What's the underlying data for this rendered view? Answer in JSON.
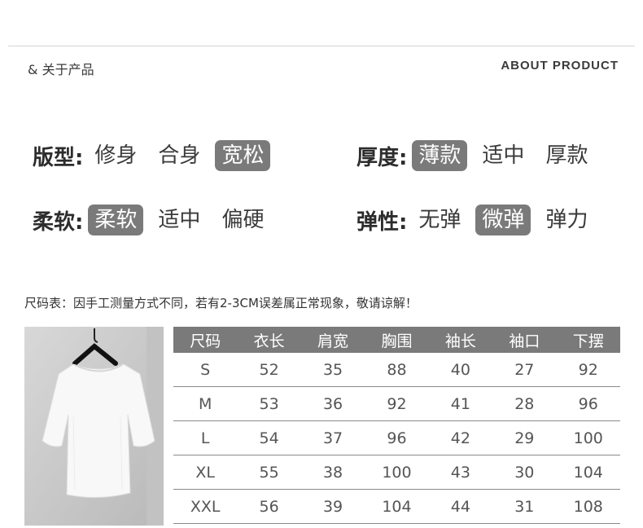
{
  "header": {
    "left": "& 关于产品",
    "right": "ABOUT PRODUCT"
  },
  "attributes": [
    {
      "label": "版型:",
      "options": [
        "修身",
        "合身",
        "宽松"
      ],
      "selected": 2
    },
    {
      "label": "厚度:",
      "options": [
        "薄款",
        "适中",
        "厚款"
      ],
      "selected": 0
    },
    {
      "label": "柔软:",
      "options": [
        "柔软",
        "适中",
        "偏硬"
      ],
      "selected": 0
    },
    {
      "label": "弹性:",
      "options": [
        "无弹",
        "微弹",
        "弹力"
      ],
      "selected": 1
    }
  ],
  "size_note": "尺码表：因手工测量方式不同，若有2-3CM误差属正常现象，敬请谅解！",
  "size_table": {
    "headers": [
      "尺码",
      "衣长",
      "肩宽",
      "胸围",
      "袖长",
      "袖口",
      "下摆"
    ],
    "rows": [
      [
        "S",
        "52",
        "35",
        "88",
        "40",
        "27",
        "92"
      ],
      [
        "M",
        "53",
        "36",
        "92",
        "41",
        "28",
        "96"
      ],
      [
        "L",
        "54",
        "37",
        "96",
        "42",
        "29",
        "100"
      ],
      [
        "XL",
        "55",
        "38",
        "100",
        "43",
        "30",
        "104"
      ],
      [
        "XXL",
        "56",
        "39",
        "104",
        "44",
        "31",
        "108"
      ]
    ]
  }
}
